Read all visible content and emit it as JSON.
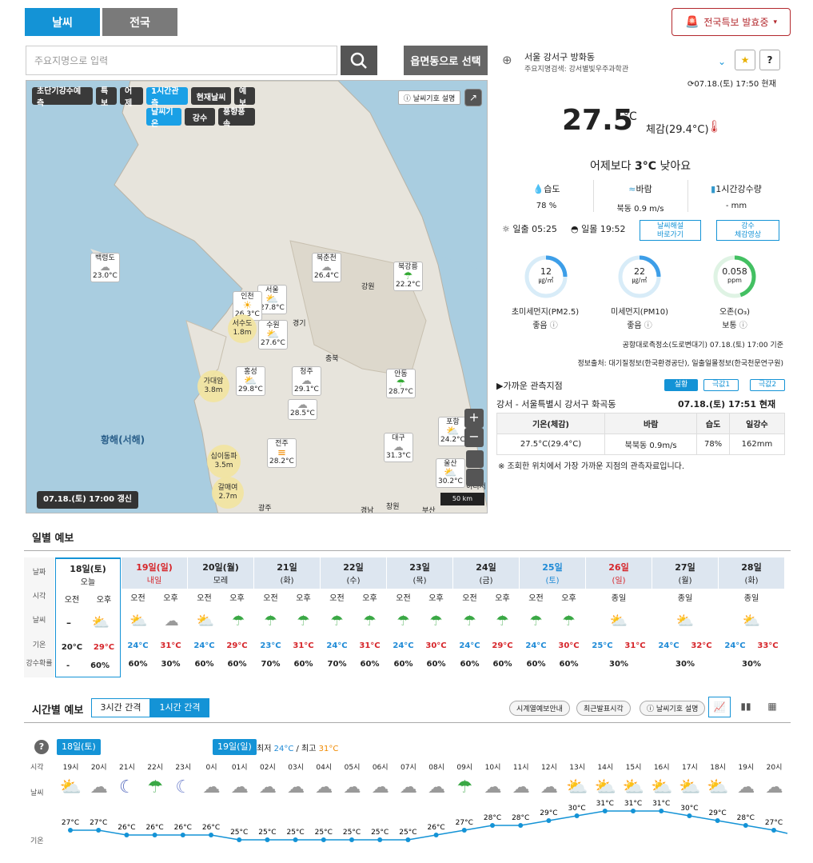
{
  "tabs": {
    "weather": "날씨",
    "nation": "전국"
  },
  "alert": {
    "label": "전국특보 발효중",
    "caret": "▾"
  },
  "search": {
    "placeholder": "주요지명으로 입력",
    "region_button": "읍면동으로 선택"
  },
  "map": {
    "buttons_row1": [
      "초단기강수예측",
      "특보",
      "어제",
      "1시간관측",
      "현재날씨",
      "예보"
    ],
    "buttons_row2": [
      "날씨기온",
      "강수",
      "풍향풍속"
    ],
    "help_label": "날씨기호 설명",
    "update_label": "07.18.(토) 17:00 갱신",
    "sea_label": "황해(서해)",
    "scale_label": "50 km",
    "stations": [
      {
        "name": "백령도",
        "temp": "23.0°C"
      },
      {
        "name": "북춘천",
        "temp": "26.4°C"
      },
      {
        "name": "북강릉",
        "temp": "22.2°C"
      },
      {
        "name": "서울",
        "temp": "27.8°C"
      },
      {
        "name": "인천",
        "temp": "26.3°C"
      },
      {
        "name": "수원",
        "temp": "27.6°C"
      },
      {
        "name": "홍성",
        "temp": "29.8°C"
      },
      {
        "name": "청주",
        "temp": "29.1°C"
      },
      {
        "name": "대전",
        "temp": "28.5°C"
      },
      {
        "name": "안동",
        "temp": "28.7°C"
      },
      {
        "name": "포항",
        "temp": "24.2°C"
      },
      {
        "name": "대구",
        "temp": "31.3°C"
      },
      {
        "name": "전주",
        "temp": "28.2°C"
      },
      {
        "name": "울산",
        "temp": "30.2°C"
      }
    ],
    "buoys": [
      {
        "name": "서수도",
        "value": "1.8m"
      },
      {
        "name": "가대암",
        "value": "3.8m"
      },
      {
        "name": "십이동파",
        "value": "3.5m"
      },
      {
        "name": "갈매여",
        "value": "2.7m"
      }
    ],
    "regions": [
      "강원",
      "경기",
      "충북",
      "경남"
    ],
    "partial_labels": [
      "광주",
      "창원",
      "부산",
      "이디서"
    ]
  },
  "current": {
    "location": "서울 강서구 방화동",
    "sublocation": "주요지명검색: 강서별빛우주과학관",
    "time": "07.18.(토) 17:50 현재",
    "temp": "27.5",
    "unit": "°C",
    "feels": "체감(29.4°C)",
    "compare_prefix": "어제보다 ",
    "compare_value": "3°C",
    "compare_suffix": " 낮아요",
    "humidity_label": "습도",
    "humidity": "78 %",
    "wind_label": "바람",
    "wind": "북동 0.9 m/s",
    "rain_label": "1시간강수량",
    "rain": "- mm",
    "sunrise": "일출  05:25",
    "sunset": "일몰  19:52",
    "btn_commentary": "날씨해설\n바로가기",
    "btn_rain_video": "강수\n체감영상"
  },
  "air": [
    {
      "value": "12",
      "unit": "㎍/㎥",
      "label": "초미세먼지(PM2.5)",
      "grade": "좋음",
      "color": "#3d9ee8",
      "pct": 0.25
    },
    {
      "value": "22",
      "unit": "㎍/㎥",
      "label": "미세먼지(PM10)",
      "grade": "좋음",
      "color": "#3d9ee8",
      "pct": 0.25
    },
    {
      "value": "0.058",
      "unit": "ppm",
      "label": "오존(O₃)",
      "grade": "보통",
      "color": "#43c062",
      "pct": 0.45
    }
  ],
  "air_meta": {
    "station": "공항대로측정소(도로변대기) 07.18.(토) 17:00 기준",
    "source": "정보출처: 대기질정보(한국환경공단), 일출일몰정보(한국천문연구원)"
  },
  "obs": {
    "title": "▶가까운 관측지점",
    "chips": [
      "실황",
      "극값1",
      "극값2"
    ],
    "station": "강서 - 서울특별시 강서구 화곡동",
    "time": "07.18.(토) 17:51 현재",
    "headers": [
      "기온(체감)",
      "바람",
      "습도",
      "일강수"
    ],
    "row": [
      "27.5°C(29.4°C)",
      "북북동 0.9m/s",
      "78%",
      "162mm"
    ],
    "note": "※ 조회한 위치에서 가장 가까운 지점의 관측자료입니다."
  },
  "daily": {
    "title": "일별 예보",
    "row_labels": [
      "날짜",
      "시각",
      "날씨",
      "기온",
      "강수확률"
    ],
    "days": [
      {
        "date": "18일(토)",
        "sub": "오늘",
        "am_pm": [
          "오전",
          "오후"
        ],
        "icons": [
          "",
          "sun-rain"
        ],
        "temps": [
          "20°C",
          "29°C"
        ],
        "pops": [
          "-",
          "60%"
        ],
        "red": false
      },
      {
        "date": "19일(일)",
        "sub": "내일",
        "am_pm": [
          "오전",
          "오후"
        ],
        "icons": [
          "sun-rain",
          "cloud"
        ],
        "temps": [
          "24°C",
          "31°C"
        ],
        "pops": [
          "60%",
          "30%"
        ],
        "red": true
      },
      {
        "date": "20일(월)",
        "sub": "모레",
        "am_pm": [
          "오전",
          "오후"
        ],
        "icons": [
          "sun-rain",
          "umbrella"
        ],
        "temps": [
          "24°C",
          "29°C"
        ],
        "pops": [
          "60%",
          "60%"
        ],
        "red": false
      },
      {
        "date": "21일",
        "sub": "(화)",
        "am_pm": [
          "오전",
          "오후"
        ],
        "icons": [
          "umbrella",
          "umbrella"
        ],
        "temps": [
          "23°C",
          "31°C"
        ],
        "pops": [
          "70%",
          "60%"
        ],
        "red": false
      },
      {
        "date": "22일",
        "sub": "(수)",
        "am_pm": [
          "오전",
          "오후"
        ],
        "icons": [
          "umbrella",
          "umbrella"
        ],
        "temps": [
          "24°C",
          "31°C"
        ],
        "pops": [
          "70%",
          "60%"
        ],
        "red": false
      },
      {
        "date": "23일",
        "sub": "(목)",
        "am_pm": [
          "오전",
          "오후"
        ],
        "icons": [
          "umbrella",
          "umbrella"
        ],
        "temps": [
          "24°C",
          "30°C"
        ],
        "pops": [
          "60%",
          "60%"
        ],
        "red": false
      },
      {
        "date": "24일",
        "sub": "(금)",
        "am_pm": [
          "오전",
          "오후"
        ],
        "icons": [
          "umbrella",
          "umbrella"
        ],
        "temps": [
          "24°C",
          "29°C"
        ],
        "pops": [
          "60%",
          "60%"
        ],
        "red": false
      },
      {
        "date": "25일",
        "sub": "(토)",
        "am_pm": [
          "오전",
          "오후"
        ],
        "icons": [
          "umbrella",
          "umbrella"
        ],
        "temps": [
          "24°C",
          "30°C"
        ],
        "pops": [
          "60%",
          "60%"
        ],
        "red": false,
        "blue": true
      },
      {
        "date": "26일",
        "sub": "(일)",
        "am_pm": [
          "종일"
        ],
        "icons": [
          "suncloud"
        ],
        "temps": [
          "25°C",
          "31°C"
        ],
        "pops": [
          "30%"
        ],
        "red": true
      },
      {
        "date": "27일",
        "sub": "(월)",
        "am_pm": [
          "종일"
        ],
        "icons": [
          "suncloud"
        ],
        "temps": [
          "24°C",
          "32°C"
        ],
        "pops": [
          "30%"
        ],
        "red": false
      },
      {
        "date": "28일",
        "sub": "(화)",
        "am_pm": [
          "종일"
        ],
        "icons": [
          "suncloud"
        ],
        "temps": [
          "24°C",
          "33°C"
        ],
        "pops": [
          "30%"
        ],
        "red": false
      }
    ]
  },
  "hourly": {
    "title": "시간별 예보",
    "tabs": [
      "3시간 간격",
      "1시간 간격"
    ],
    "buttons": [
      "시계열예보안내",
      "최근발표시각",
      "날씨기호 설명"
    ],
    "today_flag": "18일(토)",
    "tomorrow_flag": "19일(일)",
    "minmax_prefix": "최저 ",
    "min": "24°C",
    "sep": " / 최고 ",
    "max": "31°C",
    "row_labels": [
      "시각",
      "날씨",
      "기온"
    ],
    "hours": [
      "19시",
      "20시",
      "21시",
      "22시",
      "23시",
      "0시",
      "01시",
      "02시",
      "03시",
      "04시",
      "05시",
      "06시",
      "07시",
      "08시",
      "09시",
      "10시",
      "11시",
      "12시",
      "13시",
      "14시",
      "15시",
      "16시",
      "17시",
      "18시",
      "19시",
      "20시"
    ],
    "icons": [
      "suncloud",
      "cloud",
      "moon",
      "umbrella",
      "mooncloud",
      "cloud",
      "cloud",
      "cloud",
      "cloud",
      "cloud",
      "cloud",
      "cloud",
      "cloud",
      "cloud",
      "umbrella",
      "cloud",
      "cloud",
      "cloud",
      "suncloud",
      "suncloud",
      "suncloud",
      "suncloud",
      "suncloud",
      "suncloud",
      "cloud",
      "cloud"
    ],
    "temps": [
      27,
      27,
      26,
      26,
      26,
      26,
      25,
      25,
      25,
      25,
      25,
      25,
      25,
      26,
      27,
      28,
      28,
      29,
      30,
      31,
      31,
      31,
      30,
      29,
      28,
      27
    ]
  }
}
